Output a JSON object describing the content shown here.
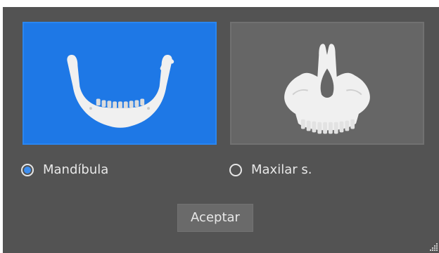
{
  "options": [
    {
      "id": "mandibula",
      "label": "Mandíbula",
      "icon": "mandible-icon",
      "selected": true,
      "tile_color": "#1e78e6"
    },
    {
      "id": "maxilar",
      "label": "Maxilar s.",
      "icon": "maxilla-icon",
      "selected": false,
      "tile_color": "#666666"
    }
  ],
  "accept_button": {
    "label": "Aceptar"
  },
  "colors": {
    "dialog_background": "#535353",
    "selected_radio_dot": "#3d8ef0",
    "bone": "#f0f0f0"
  }
}
